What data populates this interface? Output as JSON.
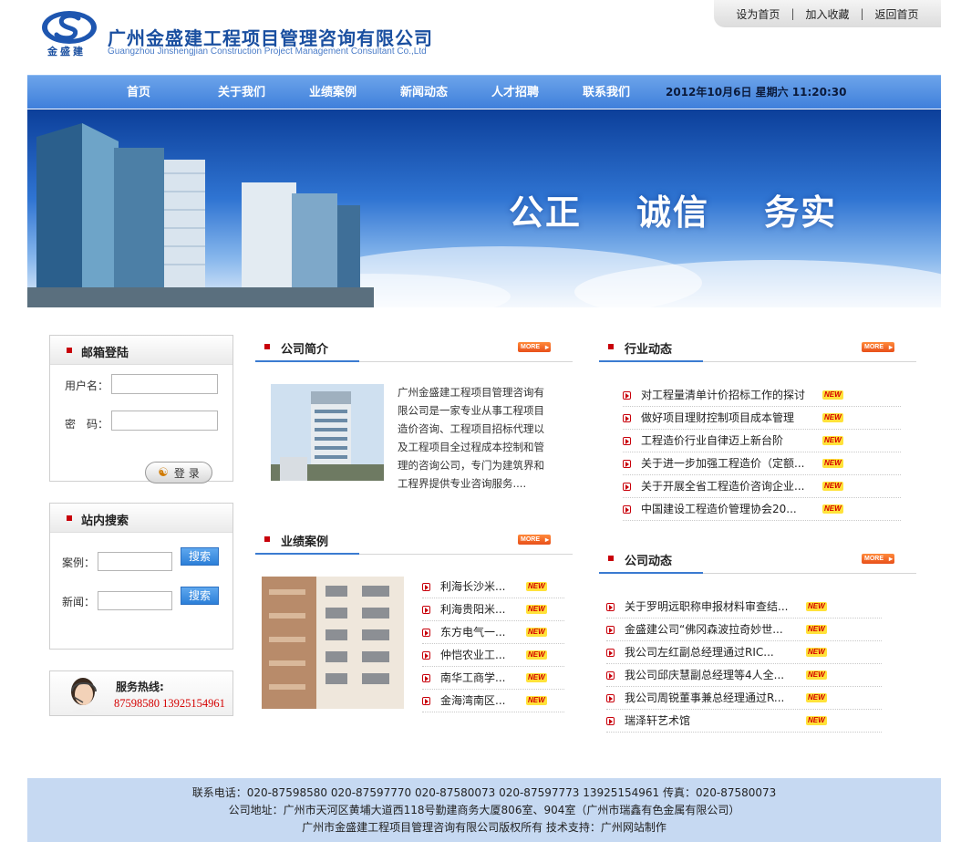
{
  "header": {
    "company_cn": "广州金盛建工程项目管理咨询有限公司",
    "company_en": "Guangzhou Jinshengjian Construction Project Management Consultant Co.,Ltd",
    "logo_text": "金盛建",
    "links": [
      "设为首页",
      "加入收藏",
      "返回首页"
    ],
    "link_sep": "|"
  },
  "nav": {
    "items": [
      "首页",
      "关于我们",
      "业绩案例",
      "新闻动态",
      "人才招聘",
      "联系我们"
    ],
    "datetime": "2012年10月6日 星期六 11:20:30"
  },
  "banner": {
    "slogans": [
      "公正",
      "诚信",
      "务实"
    ]
  },
  "login": {
    "title": "邮箱登陆",
    "username_label": "用户名：",
    "password_label": "密　码：",
    "button": "登 录"
  },
  "search": {
    "title": "站内搜索",
    "case_label": "案例：",
    "news_label": "新闻：",
    "button": "搜索"
  },
  "hotline": {
    "label": "服务热线:",
    "numbers": "87598580 13925154961"
  },
  "more_label": "MORE",
  "new_label": "NEW",
  "intro": {
    "title": "公司简介",
    "text": "广州金盛建工程项目管理咨询有限公司是一家专业从事工程项目造价咨询、工程项目招标代理以及工程项目全过程成本控制和管理的咨询公司，专门为建筑界和工程界提供专业咨询服务...."
  },
  "cases": {
    "title": "业绩案例",
    "items": [
      "利海长沙米...",
      "利海贵阳米...",
      "东方电气一...",
      "仲恺农业工...",
      "南华工商学...",
      "金海湾南区..."
    ]
  },
  "industry": {
    "title": "行业动态",
    "items": [
      "对工程量清单计价招标工作的探讨",
      "做好项目理财控制项目成本管理",
      "工程造价行业自律迈上新台阶",
      "关于进一步加强工程造价（定额...",
      "关于开展全省工程造价咨询企业...",
      "中国建设工程造价管理协会20..."
    ]
  },
  "company_news": {
    "title": "公司动态",
    "items": [
      "关于罗明远职称申报材料审查结...",
      "金盛建公司“佛冈森波拉奇妙世...",
      "我公司左红副总经理通过RIC...",
      "我公司邱庆慧副总经理等4人全...",
      "我公司周锐董事兼总经理通过R...",
      "瑞泽轩艺术馆"
    ]
  },
  "footer": {
    "line1": "联系电话：020-87598580 020-87597770 020-87580073 020-87597773 13925154961 传真：020-87580073",
    "line2": "公司地址：广州市天河区黄埔大道西118号勤建商务大厦806室、904室（广州市瑞鑫有色金属有限公司）",
    "line3": "广州市金盛建工程项目管理咨询有限公司版权所有 技术支持：广州网站制作"
  },
  "colors": {
    "nav": "#4f8ee3",
    "accent_red": "#c8000a",
    "brand_blue": "#1a4fa0",
    "footer_bg": "#c6d9f2"
  }
}
